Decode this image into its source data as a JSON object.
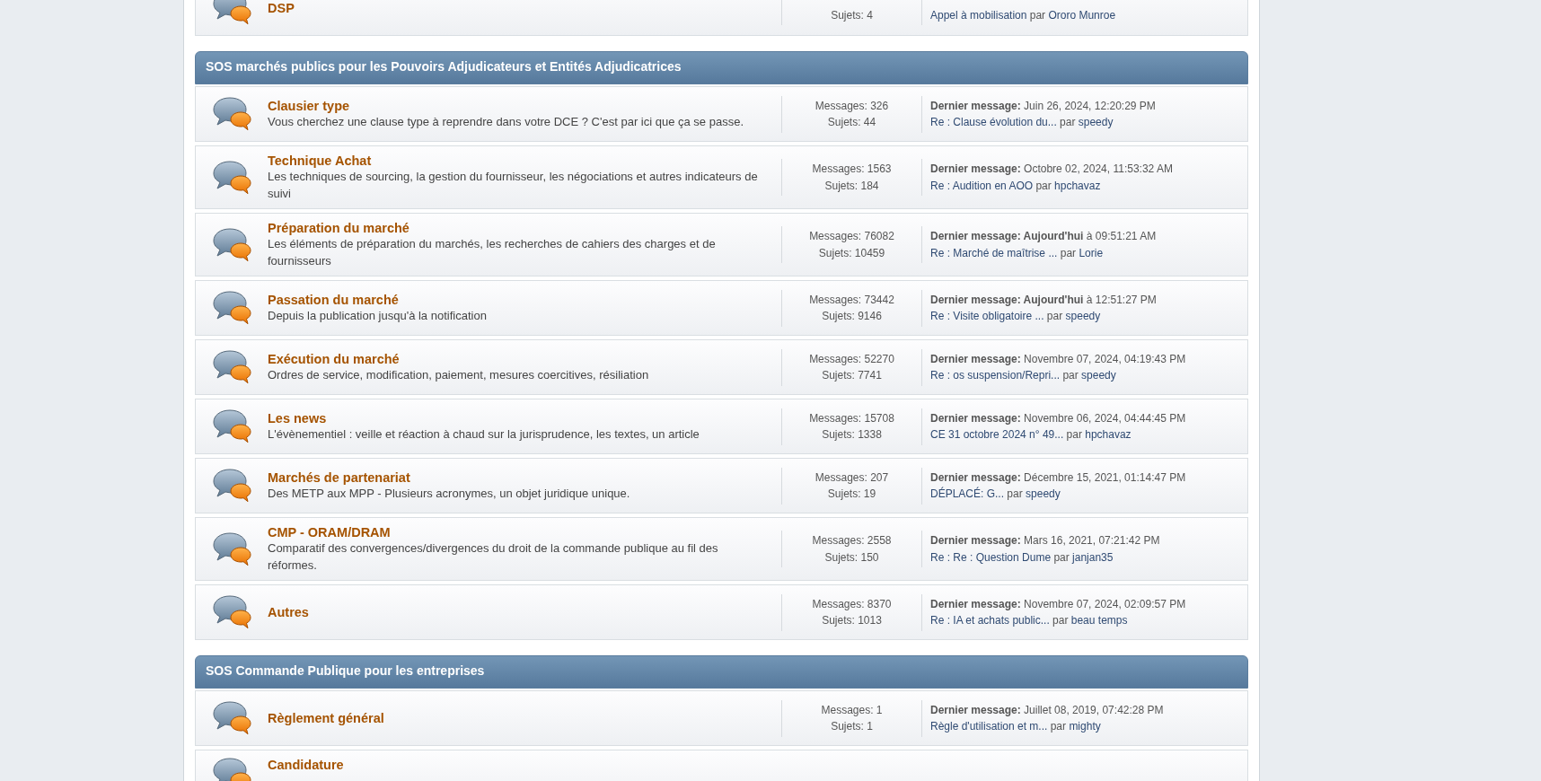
{
  "sections": [
    {
      "boards": [
        {
          "name": "DSP",
          "topics": "Sujets: 4",
          "last_post": {
            "topic": "Appel à mobilisation",
            "by": "par",
            "author": "Ororo Munroe"
          }
        }
      ]
    },
    {
      "header": "SOS marchés publics pour les Pouvoirs Adjudicateurs et Entités Adjudicatrices",
      "boards": [
        {
          "name": "Clausier type",
          "description": "Vous cherchez une clause type à reprendre dans votre DCE ? C'est par ici que ça se passe.",
          "messages": "Messages: 326",
          "topics": "Sujets: 44",
          "last_post": {
            "info": "**Dernier message:** Juin 26, 2024, 12:20:29 PM",
            "topic": "Re : Clause évolution du...",
            "by": "par",
            "author": "speedy"
          }
        },
        {
          "name": "Technique Achat",
          "description": "Les techniques de sourcing, la gestion du fournisseur, les négociations et autres indicateurs de suivi",
          "messages": "Messages: 1563",
          "topics": "Sujets: 184",
          "last_post": {
            "info": "**Dernier message:** Octobre 02, 2024, 11:53:32 AM",
            "topic": "Re : Audition en AOO",
            "by": "par",
            "author": "hpchavaz"
          }
        },
        {
          "name": "Préparation du marché",
          "description": "Les éléments de préparation du marchés, les recherches de cahiers des charges et de fournisseurs",
          "messages": "Messages: 76082",
          "topics": "Sujets: 10459",
          "last_post": {
            "info": "**Dernier message: Aujourd'hui** à 09:51:21 AM",
            "topic": "Re : Marché de maîtrise ...",
            "by": "par",
            "author": "Lorie"
          }
        },
        {
          "name": "Passation du marché",
          "description": "Depuis la publication jusqu'à  la notification",
          "messages": "Messages: 73442",
          "topics": "Sujets: 9146",
          "last_post": {
            "info": "**Dernier message: Aujourd'hui** à 12:51:27 PM",
            "topic": "Re : Visite obligatoire ...",
            "by": "par",
            "author": "speedy"
          }
        },
        {
          "name": "Exécution du marché",
          "description": "Ordres de service, modification, paiement, mesures coercitives, résiliation",
          "messages": "Messages: 52270",
          "topics": "Sujets: 7741",
          "last_post": {
            "info": "**Dernier message:** Novembre 07, 2024, 04:19:43 PM",
            "topic": "Re : os suspension/Repri...",
            "by": "par",
            "author": "speedy"
          }
        },
        {
          "name": "Les news",
          "description": "L'évènementiel : veille et réaction à chaud sur la jurisprudence, les textes, un article",
          "messages": "Messages: 15708",
          "topics": "Sujets: 1338",
          "last_post": {
            "info": "**Dernier message:** Novembre 06, 2024, 04:44:45 PM",
            "topic": "CE 31 octobre 2024 n° 49...",
            "by": "par",
            "author": "hpchavaz"
          }
        },
        {
          "name": "Marchés de partenariat",
          "description": "Des METP aux MPP - Plusieurs acronymes, un objet juridique unique.",
          "messages": "Messages: 207",
          "topics": "Sujets: 19",
          "last_post": {
            "info": "**Dernier message:** Décembre 15, 2021, 01:14:47 PM",
            "topic": "DÉPLACÉ: G...",
            "by": "par",
            "author": "speedy"
          }
        },
        {
          "name": "CMP - ORAM/DRAM",
          "description": "Comparatif des convergences/divergences du droit de la commande publique au fil des réformes.",
          "messages": "Messages: 2558",
          "topics": "Sujets: 150",
          "last_post": {
            "info": "**Dernier message:** Mars 16, 2021, 07:21:42 PM",
            "topic": "Re : Re : Question Dume",
            "by": "par",
            "author": "janjan35"
          }
        },
        {
          "name": "Autres",
          "messages": "Messages: 8370",
          "topics": "Sujets: 1013",
          "last_post": {
            "info": "**Dernier message:** Novembre 07, 2024, 02:09:57 PM",
            "topic": "Re : IA et achats public...",
            "by": "par",
            "author": "beau temps"
          }
        }
      ]
    },
    {
      "header": "SOS Commande Publique pour les entreprises",
      "boards": [
        {
          "name": "Règlement général",
          "messages": "Messages: 1",
          "topics": "Sujets: 1",
          "last_post": {
            "info": "**Dernier message:** Juillet 08, 2019, 07:42:28 PM",
            "topic": "Règle d'utilisation et m...",
            "by": "par",
            "author": "mighty"
          }
        },
        {
          "name": "Candidature"
        }
      ]
    }
  ]
}
